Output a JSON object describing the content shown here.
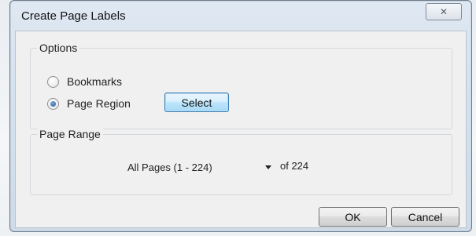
{
  "window": {
    "title": "Create Page Labels",
    "close_glyph": "✕"
  },
  "options": {
    "group_label": "Options",
    "radios": [
      {
        "label": "Bookmarks",
        "checked": false
      },
      {
        "label": "Page Region",
        "checked": true
      }
    ],
    "select_button": "Select"
  },
  "page_range": {
    "group_label": "Page Range",
    "selected": "All Pages (1 - 224)",
    "of_text": "of 224"
  },
  "footer": {
    "ok": "OK",
    "cancel": "Cancel"
  }
}
